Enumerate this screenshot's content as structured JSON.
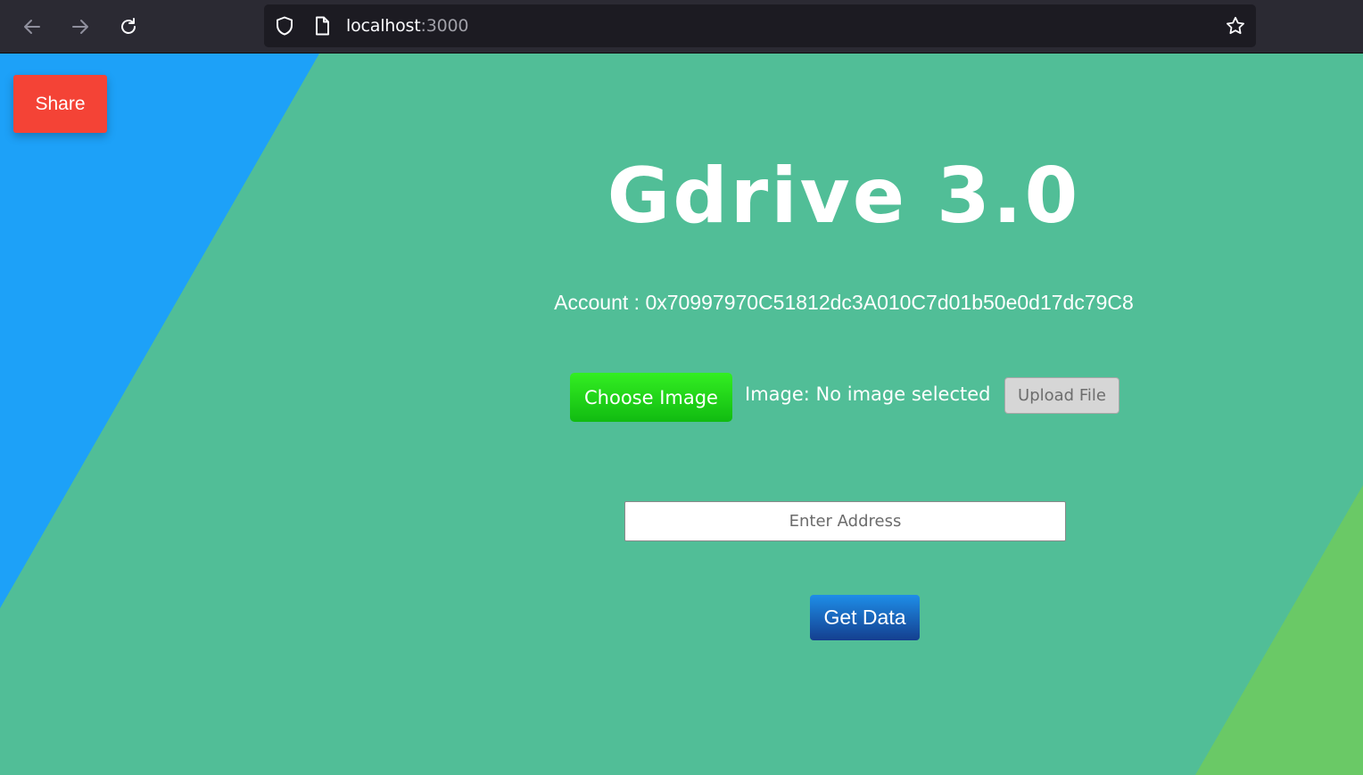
{
  "browser": {
    "url_host": "localhost",
    "url_port": ":3000",
    "icons": {
      "back": "arrow-left-icon",
      "forward": "arrow-right-icon",
      "reload": "reload-icon",
      "shield": "shield-icon",
      "page": "page-icon",
      "bookmark": "star-icon"
    }
  },
  "page": {
    "share_label": "Share",
    "title": "Gdrive 3.0",
    "account_text": "Account : 0x70997970C51812dc3A010C7d01b50e0d17dc79C8",
    "choose_label": "Choose Image",
    "image_status": "Image: No image selected",
    "upload_label": "Upload File",
    "address_placeholder": "Enter Address",
    "get_data_label": "Get Data"
  },
  "colors": {
    "background": "#51be97",
    "left_panel": "#1da1f8",
    "right_corner": "#6ac966",
    "share_button": "#f44336",
    "choose_button": "#22cc11",
    "get_data_button": "#1a66c0"
  }
}
